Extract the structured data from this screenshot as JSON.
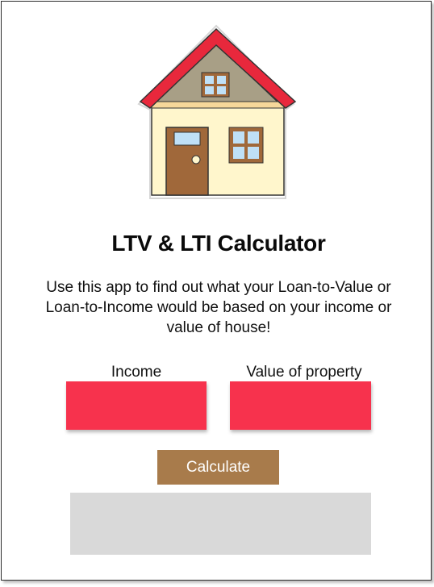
{
  "app": {
    "title": "LTV & LTI Calculator",
    "description": "Use this app to find out what your Loan-to-Value or Loan-to-Income would be based on your income or value of house!",
    "logo_icon": "house-icon"
  },
  "form": {
    "income_label": "Income",
    "income_value": "",
    "property_label": "Value of property",
    "property_value": "",
    "calculate_label": "Calculate"
  },
  "result": {
    "text": ""
  },
  "colors": {
    "input_bg": "#f7324d",
    "button_bg": "#a87b4b",
    "result_bg": "#d9d9d9",
    "roof": "#e8283c",
    "wall": "#fff6cc",
    "door": "#a0683a"
  }
}
